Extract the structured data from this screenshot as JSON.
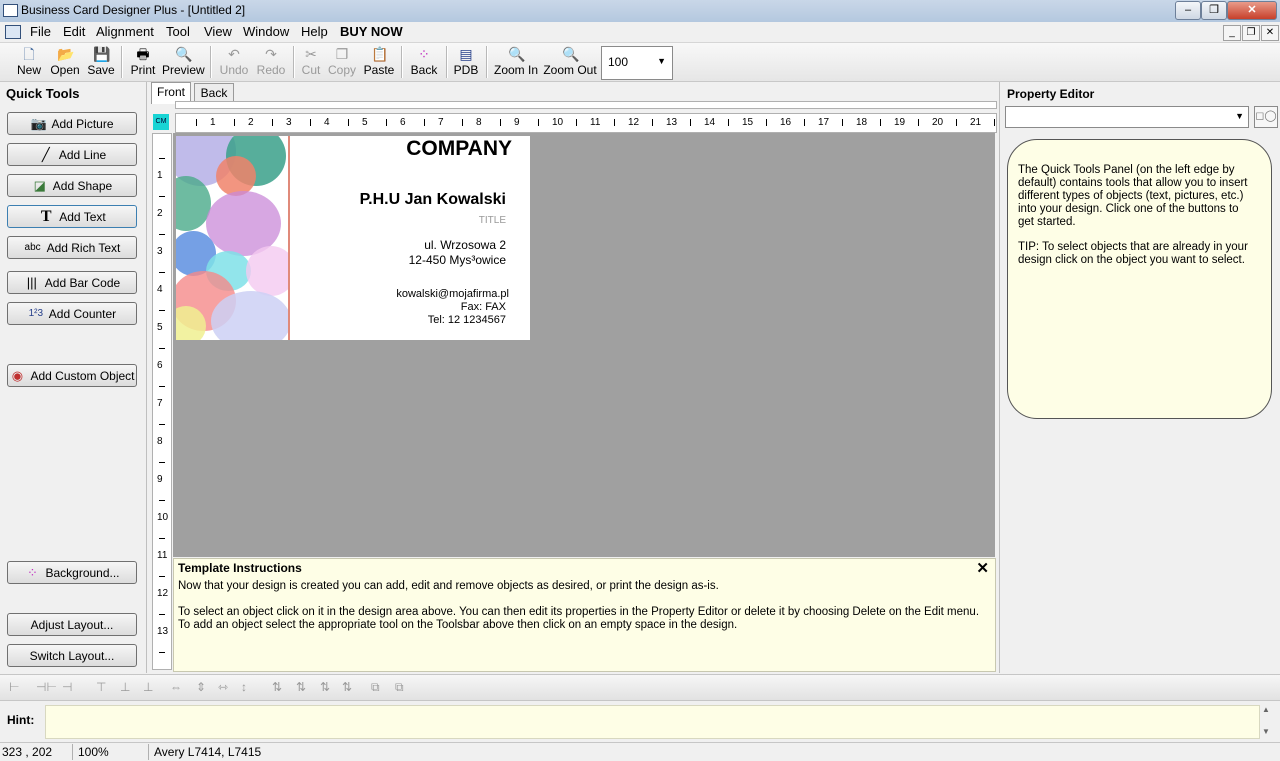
{
  "window": {
    "title": "Business Card Designer Plus  - [Untitled 2]"
  },
  "menu": [
    "File",
    "Edit",
    "Alignment",
    "Tool",
    "View",
    "Window",
    "Help",
    "BUY NOW"
  ],
  "toolbar": {
    "new": "New",
    "open": "Open",
    "save": "Save",
    "print": "Print",
    "preview": "Preview",
    "undo": "Undo",
    "redo": "Redo",
    "cut": "Cut",
    "copy": "Copy",
    "paste": "Paste",
    "back": "Back",
    "pdb": "PDB",
    "zoom_in": "Zoom In",
    "zoom_out": "Zoom Out",
    "zoom_value": "100"
  },
  "quick_tools": {
    "title": "Quick Tools",
    "add_picture": "Add Picture",
    "add_line": "Add Line",
    "add_shape": "Add Shape",
    "add_text": "Add Text",
    "add_rich_text": "Add Rich Text",
    "add_bar_code": "Add Bar Code",
    "add_counter": "Add Counter",
    "add_custom_object": "Add Custom Object",
    "background": "Background...",
    "adjust_layout": "Adjust Layout...",
    "switch_layout": "Switch Layout..."
  },
  "tabs": {
    "front": "Front",
    "back": "Back"
  },
  "ruler": {
    "unit": "CM",
    "h": [
      "1",
      "2",
      "3",
      "4",
      "5",
      "6",
      "7",
      "8",
      "9",
      "10",
      "11",
      "12",
      "13",
      "14",
      "15",
      "16",
      "17",
      "18",
      "19",
      "20",
      "21"
    ],
    "v": [
      "1",
      "2",
      "3",
      "4",
      "5",
      "6",
      "7",
      "8",
      "9",
      "10",
      "11",
      "12",
      "13"
    ]
  },
  "card": {
    "company": "COMPANY",
    "name": "P.H.U Jan Kowalski",
    "title": "TITLE",
    "street": "ul. Wrzosowa 2",
    "city": "12-450 Mys³owice",
    "email": "kowalski@mojafirma.pl",
    "fax": "Fax: FAX",
    "tel": "Tel: 12 1234567"
  },
  "instructions": {
    "title": "Template Instructions",
    "p1": "Now that your design is created you can add, edit and remove objects as desired, or print the design as-is.",
    "p2": "To select an object click on it in the design area above. You can then edit its properties in the Property Editor or delete it by choosing Delete on the Edit menu. To add an object select the appropriate tool on the Toolsbar above then click on an empty space in the design."
  },
  "property_editor": {
    "title": "Property Editor",
    "help1": "The Quick Tools Panel (on the left edge by default) contains tools that allow you to insert different types of objects (text, pictures, etc.) into your design. Click one of the buttons to get started.",
    "help2": "TIP: To select objects that are already in your design click on the object you want to select."
  },
  "hint": {
    "label": "Hint:"
  },
  "status": {
    "coords": "323 , 202",
    "zoom": "100%",
    "layout": "Avery L7414, L7415"
  }
}
